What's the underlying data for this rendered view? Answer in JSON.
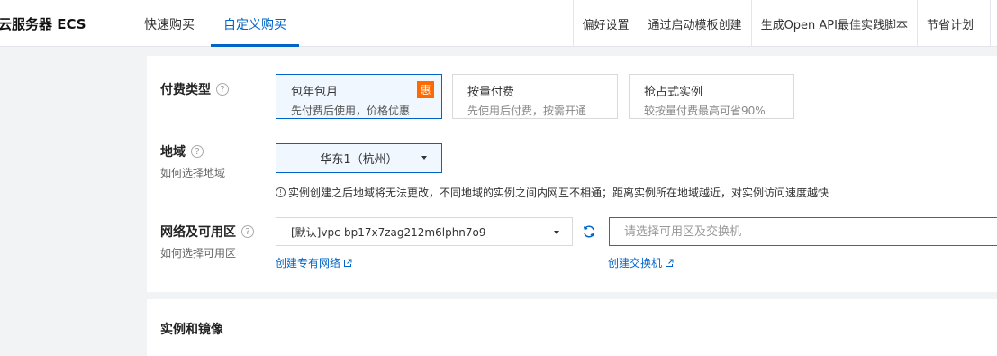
{
  "header": {
    "brand": "云服务器 ECS",
    "tabs": [
      "快速购买",
      "自定义购买"
    ],
    "right_links": [
      "偏好设置",
      "通过启动模板创建",
      "生成Open API最佳实践脚本",
      "节省计划"
    ]
  },
  "billing": {
    "label": "付费类型",
    "options": [
      {
        "title": "包年包月",
        "desc": "先付费后使用，价格优惠",
        "badge": "惠"
      },
      {
        "title": "按量付费",
        "desc": "先使用后付费，按需开通"
      },
      {
        "title": "抢占式实例",
        "desc": "较按量付费最高可省90%"
      }
    ]
  },
  "region": {
    "label": "地域",
    "help_link": "如何选择地域",
    "value": "华东1（杭州）",
    "notice": "实例创建之后地域将无法更改，不同地域的实例之间内网互不相通；距离实例所在地域越近，对实例访问速度越快"
  },
  "network": {
    "label": "网络及可用区",
    "help_link": "如何选择可用区",
    "vpc_value": "[默认]vpc-bp17x7zag212m6lphn7o9",
    "switch_placeholder": "请选择可用区及交换机",
    "create_vpc_link": "创建专有网络",
    "create_switch_link": "创建交换机"
  },
  "section2": {
    "title": "实例和镜像"
  },
  "colors": {
    "accent": "#0064c8",
    "badge": "#ff6a00",
    "error_border": "#d0312d"
  }
}
